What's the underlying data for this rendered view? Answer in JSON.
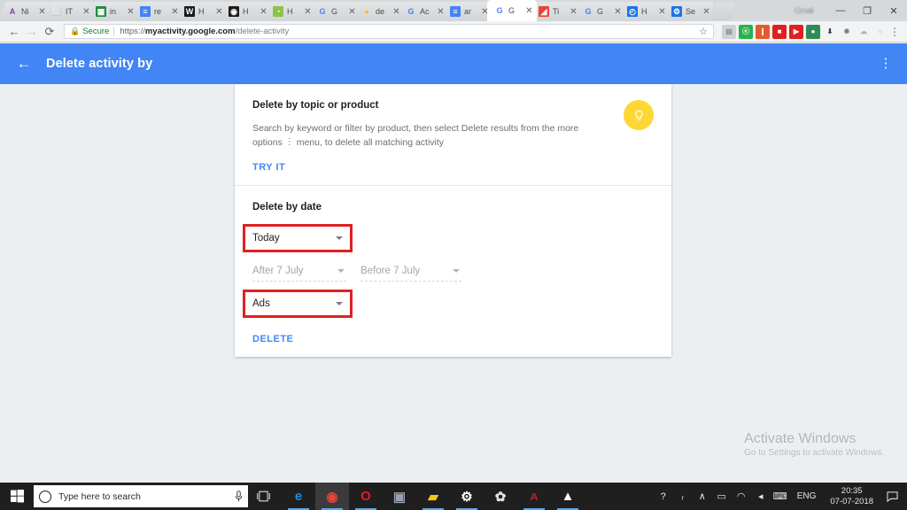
{
  "browser": {
    "tabs": [
      {
        "title": "Ni",
        "icon": "letter-a-icon",
        "icon_glyph": "A",
        "icon_color": "#7b3fa0",
        "icon_bg": "#ffffff",
        "active": false
      },
      {
        "title": "IT",
        "icon": "document-icon",
        "icon_glyph": "⬜",
        "icon_color": "#9aa0a6",
        "icon_bg": "#ffffff",
        "active": false
      },
      {
        "title": "in",
        "icon": "google-sheets-icon",
        "icon_glyph": "▦",
        "icon_color": "#ffffff",
        "icon_bg": "#1e8e3e",
        "active": false
      },
      {
        "title": "re",
        "icon": "google-docs-icon",
        "icon_glyph": "≡",
        "icon_color": "#ffffff",
        "icon_bg": "#4285f4",
        "active": false
      },
      {
        "title": "H",
        "icon": "wikipedia-icon",
        "icon_glyph": "W",
        "icon_color": "#ffffff",
        "icon_bg": "#1b1b1b",
        "active": false
      },
      {
        "title": "H",
        "icon": "camera-icon",
        "icon_glyph": "◉",
        "icon_color": "#ffffff",
        "icon_bg": "#1b1b1b",
        "active": false
      },
      {
        "title": "H",
        "icon": "android-icon",
        "icon_glyph": "◔",
        "icon_color": "#ffffff",
        "icon_bg": "#8bc34a",
        "active": false
      },
      {
        "title": "G",
        "icon": "google-icon",
        "icon_glyph": "G",
        "icon_color": "#4285f4",
        "icon_bg": "#ffffff",
        "active": false
      },
      {
        "title": "de",
        "icon": "yellow-blob-icon",
        "icon_glyph": "●",
        "icon_color": "#f5c518",
        "icon_bg": "#ffffff",
        "active": false
      },
      {
        "title": "Ac",
        "icon": "google-icon",
        "icon_glyph": "G",
        "icon_color": "#4285f4",
        "icon_bg": "#ffffff",
        "active": false
      },
      {
        "title": "ar",
        "icon": "google-docs-icon",
        "icon_glyph": "≡",
        "icon_color": "#ffffff",
        "icon_bg": "#4285f4",
        "active": false
      },
      {
        "title": "G",
        "icon": "google-icon",
        "icon_glyph": "G",
        "icon_color": "#4285f4",
        "icon_bg": "#ffffff",
        "active": true
      },
      {
        "title": "Ti",
        "icon": "google-photos-icon",
        "icon_glyph": "◢",
        "icon_color": "#ffffff",
        "icon_bg": "#ea4335",
        "active": false
      },
      {
        "title": "G",
        "icon": "google-icon",
        "icon_glyph": "G",
        "icon_color": "#4285f4",
        "icon_bg": "#ffffff",
        "active": false
      },
      {
        "title": "H",
        "icon": "history-clock-icon",
        "icon_glyph": "◴",
        "icon_color": "#ffffff",
        "icon_bg": "#1a73e8",
        "active": false
      },
      {
        "title": "Se",
        "icon": "settings-gear-icon",
        "icon_glyph": "⚙",
        "icon_color": "#ffffff",
        "icon_bg": "#1a73e8",
        "active": false
      }
    ],
    "window_blurred_label": "Gmail",
    "window_minimize": "—",
    "window_restore": "❐",
    "window_close": "✕",
    "nav": {
      "back": "←",
      "forward": "→",
      "reload": "⟳"
    },
    "omnibox": {
      "lock_label": "Secure",
      "url_scheme": "https://",
      "url_host": "myactivity.google.com",
      "url_path": "/delete-activity",
      "star_icon": "☆"
    },
    "extensions": [
      {
        "name": "image-extension-icon",
        "glyph": "▤",
        "bg": "#cfd2d4",
        "color": "#8a8d90"
      },
      {
        "name": "evernote-extension-icon",
        "glyph": "ⓔ",
        "bg": "#27b34a",
        "color": "#ffffff"
      },
      {
        "name": "lastpass-extension-icon",
        "glyph": "❙",
        "bg": "#e35b2c",
        "color": "#ffffff"
      },
      {
        "name": "recorder-extension-icon",
        "glyph": "■",
        "bg": "#e02020",
        "color": "#ffffff"
      },
      {
        "name": "video-download-extension-icon",
        "glyph": "▶",
        "bg": "#e02020",
        "color": "#ffffff"
      },
      {
        "name": "globe-extension-icon",
        "glyph": "●",
        "bg": "#2e8b57",
        "color": "#ffffff"
      },
      {
        "name": "download-arrow-icon",
        "glyph": "⬇",
        "bg": "transparent",
        "color": "#3c4043"
      },
      {
        "name": "puzzle-extension-icon",
        "glyph": "✹",
        "bg": "transparent",
        "color": "#7a7d80"
      },
      {
        "name": "cloud-extension-icon",
        "glyph": "☁",
        "bg": "transparent",
        "color": "#b0b3b6"
      },
      {
        "name": "profile-avatar-icon",
        "glyph": "○",
        "bg": "transparent",
        "color": "#b0b3b6"
      }
    ],
    "menu_icon": "⋮"
  },
  "appbar": {
    "back_icon": "←",
    "title": "Delete activity by",
    "menu_icon": "⋮",
    "accent_color": "#4285f4"
  },
  "card": {
    "topic_section": {
      "title": "Delete by topic or product",
      "body_before": "Search by keyword or filter by product, then select Delete results from the more options",
      "body_after": "menu, to delete all matching activity",
      "inline_menu_icon": "⋮",
      "action_label": "TRY IT",
      "bulb_icon": "ᵒ",
      "bulb_color": "#fdd835"
    },
    "date_section": {
      "title": "Delete by date",
      "period_dropdown": {
        "value": "Today",
        "highlighted": true
      },
      "after_dropdown": {
        "value": "After 7 July",
        "disabled": true
      },
      "before_dropdown": {
        "value": "Before 7 July",
        "disabled": true
      },
      "product_dropdown": {
        "value": "Ads",
        "highlighted": true
      },
      "action_label": "DELETE",
      "highlight_color": "#e02020",
      "link_color": "#4285f4"
    }
  },
  "watermark": {
    "line1": "Activate Windows",
    "line2": "Go to Settings to activate Windows."
  },
  "taskbar": {
    "start_icon": "windows-logo-icon",
    "search_placeholder": "Type here to search",
    "mic_icon": "ᵒ",
    "taskview_icon": "task-view-icon",
    "apps": [
      {
        "name": "microsoft-edge-icon",
        "glyph": "e",
        "color": "#1b8fe0",
        "running": true,
        "active": false
      },
      {
        "name": "google-chrome-icon",
        "glyph": "◉",
        "color": "#e8453c",
        "running": true,
        "active": true
      },
      {
        "name": "opera-icon",
        "glyph": "O",
        "color": "#e8192c",
        "running": true,
        "active": false
      },
      {
        "name": "app-window-icon",
        "glyph": "▣",
        "color": "#9aa3ad",
        "running": false,
        "active": false
      },
      {
        "name": "file-explorer-icon",
        "glyph": "▰",
        "color": "#f5c518",
        "running": true,
        "active": false
      },
      {
        "name": "settings-gear-icon",
        "glyph": "⚙",
        "color": "#ffffff",
        "running": true,
        "active": false
      },
      {
        "name": "paint-app-icon",
        "glyph": "✿",
        "color": "#dde2e7",
        "running": false,
        "active": false
      },
      {
        "name": "adobe-reader-icon",
        "glyph": "ᴀ",
        "color": "#b0202a",
        "running": true,
        "active": false
      },
      {
        "name": "photos-app-icon",
        "glyph": "▲",
        "color": "#ffffff",
        "running": true,
        "active": false
      }
    ],
    "tray": [
      {
        "name": "help-support-icon",
        "glyph": "?"
      },
      {
        "name": "user-share-icon",
        "glyph": "ᵣ"
      },
      {
        "name": "show-hidden-icons-chevron",
        "glyph": "∧"
      },
      {
        "name": "battery-icon",
        "glyph": "▭"
      },
      {
        "name": "wifi-icon",
        "glyph": "◠"
      },
      {
        "name": "volume-icon",
        "glyph": "◂"
      },
      {
        "name": "keyboard-icon",
        "glyph": "⌨"
      }
    ],
    "language": "ENG",
    "clock_time": "20:35",
    "clock_date": "07-07-2018",
    "action_center_icon": "▭"
  }
}
